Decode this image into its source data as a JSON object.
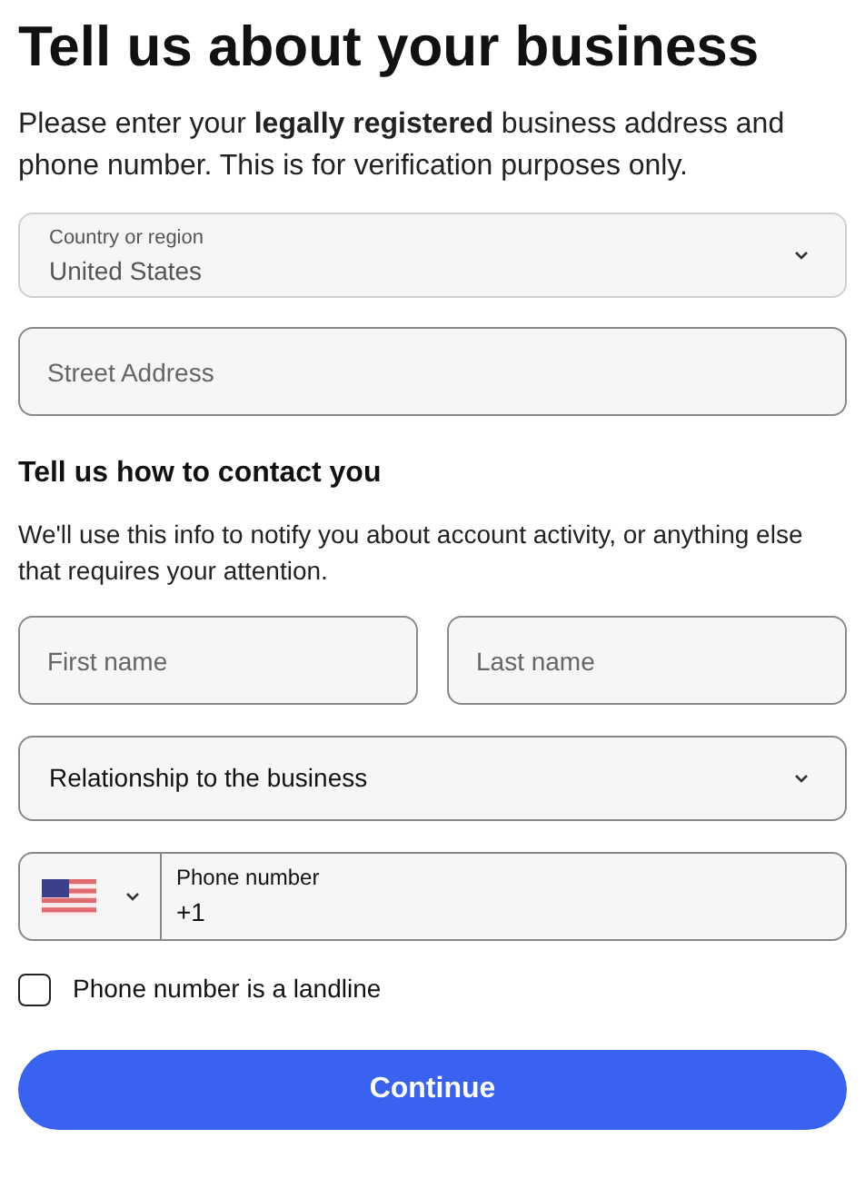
{
  "title": "Tell us about your business",
  "intro": "Please enter your **legally registered** business address and phone number. This is for verification purposes only.",
  "country": {
    "label": "Country or region",
    "value": "United States",
    "disabled": true
  },
  "street": {
    "placeholder": "Street Address"
  },
  "contact_heading": "Tell us how to contact you",
  "contact_text": "We'll use this info to notify you about account activity, or anything else that requires your attention.",
  "first_name": {
    "placeholder": "First name"
  },
  "last_name": {
    "placeholder": "Last name"
  },
  "relationship": {
    "value": "Relationship to the business"
  },
  "phone": {
    "label": "Phone number",
    "value": "+1"
  },
  "landline": {
    "label": "Phone number is a landline",
    "checked": false
  },
  "continue_button": "Continue"
}
